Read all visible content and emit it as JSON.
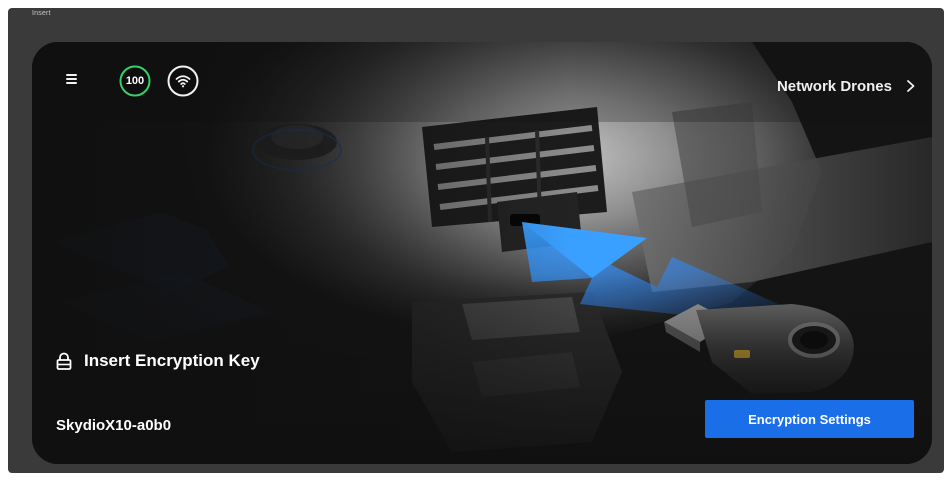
{
  "frame": {
    "label": "Insert"
  },
  "header": {
    "battery_level": "100",
    "network_link_label": "Network Drones"
  },
  "main": {
    "title": "Insert Encryption Key",
    "drone_name": "SkydioX10-a0b0",
    "encryption_button_label": "Encryption Settings"
  },
  "colors": {
    "accent_blue": "#1A6EE8",
    "battery_green": "#35D06A",
    "background": "#101010"
  },
  "icons": {
    "menu": "hamburger-menu-icon",
    "battery": "battery-ring-icon",
    "wifi": "wifi-icon",
    "chevron": "chevron-right-icon",
    "lock": "lock-icon"
  }
}
